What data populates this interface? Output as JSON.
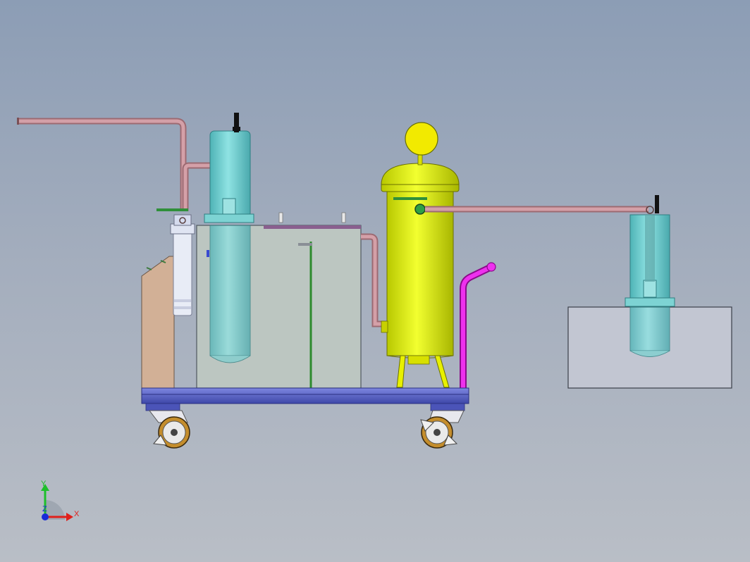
{
  "axis_triad": {
    "x_label": "X",
    "y_label": "Y",
    "z_label": "Z",
    "x_color": "#e0201b",
    "y_color": "#1dbf2a",
    "z_color": "#1a2bd8"
  },
  "colors": {
    "pipe": "#c98b94",
    "filter_vessel": "#77cfd0",
    "tank_body": "#d9f000",
    "gauge": "#f0e800",
    "frame": "#5a63c8",
    "reservoir": "#b9c0c4",
    "magenta_pipe": "#e01ce0",
    "control_panel": "#cfae94",
    "background_top": "#8c9db5",
    "background_bottom": "#b9bec6"
  },
  "components": [
    "inlet-pipe",
    "prefilter-housing",
    "filter-vessel-left",
    "water-reservoir-box",
    "pressure-tank",
    "pressure-gauge",
    "handle-pipe",
    "filter-vessel-right",
    "external-tank",
    "cart-frame",
    "caster-wheels",
    "control-panel"
  ]
}
